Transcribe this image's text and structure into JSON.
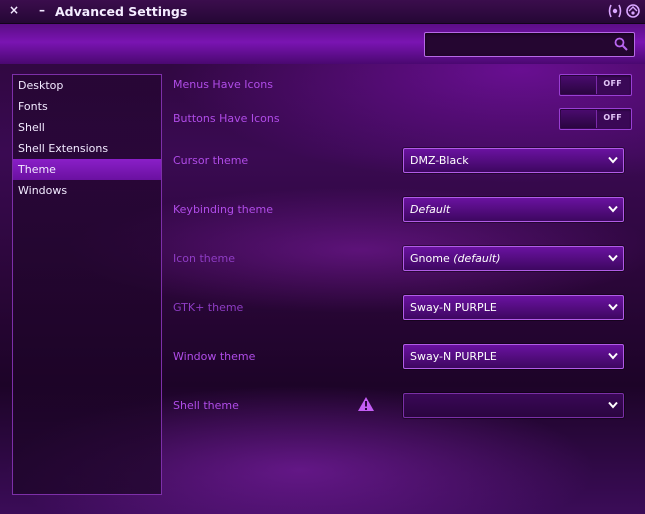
{
  "window": {
    "title": "Advanced Settings",
    "close_symbol": "×",
    "minimize_symbol": "–"
  },
  "search": {
    "placeholder": "",
    "value": "",
    "icon": "search-icon"
  },
  "sidebar": {
    "items": [
      {
        "label": "Desktop",
        "selected": false
      },
      {
        "label": "Fonts",
        "selected": false
      },
      {
        "label": "Shell",
        "selected": false
      },
      {
        "label": "Shell Extensions",
        "selected": false
      },
      {
        "label": "Theme",
        "selected": true
      },
      {
        "label": "Windows",
        "selected": false
      }
    ]
  },
  "settings": {
    "menus_have_icons": {
      "label": "Menus Have Icons",
      "state": "OFF"
    },
    "buttons_have_icons": {
      "label": "Buttons Have Icons",
      "state": "OFF"
    },
    "cursor_theme": {
      "label": "Cursor theme",
      "value": "DMZ-Black"
    },
    "keybinding_theme": {
      "label": "Keybinding theme",
      "value": "Default"
    },
    "icon_theme": {
      "label": "Icon theme",
      "value_main": "Gnome",
      "value_suffix": "(default)"
    },
    "gtk_theme": {
      "label": "GTK+ theme",
      "value": "Sway-N PURPLE"
    },
    "window_theme": {
      "label": "Window theme",
      "value": "Sway-N PURPLE"
    },
    "shell_theme": {
      "label": "Shell theme",
      "value": "",
      "warning_icon": "warning-icon"
    }
  },
  "colors": {
    "accent": "#8a1fc8",
    "label": "#b04ce8",
    "header": "#7a14b2"
  }
}
